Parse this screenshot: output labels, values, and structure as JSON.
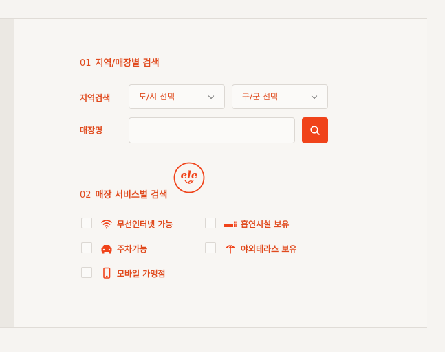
{
  "region_section": {
    "number": "01",
    "title": "지역/매장별 검색",
    "region_label": "지역검색",
    "city_select": "도/시 선택",
    "district_select": "구/군 선택",
    "store_name_label": "매장명",
    "store_name_value": "",
    "search_icon": "search-icon"
  },
  "service_section": {
    "number": "02",
    "title": "매장 서비스별 검색",
    "options": [
      {
        "label": "무선인터넷 가능",
        "icon": "wifi-icon",
        "checked": false
      },
      {
        "label": "흡연시설 보유",
        "icon": "cigarette-icon",
        "checked": false
      },
      {
        "label": "주차가능",
        "icon": "car-icon",
        "checked": false
      },
      {
        "label": "야외테라스 보유",
        "icon": "umbrella-icon",
        "checked": false
      },
      {
        "label": "모바일 가맹점",
        "icon": "mobile-icon",
        "checked": false
      }
    ]
  },
  "logo_text": "ele",
  "colors": {
    "accent": "#f0431a",
    "text_accent": "#e04a1d",
    "background": "#f8f6f3",
    "border": "#dcd8d3"
  }
}
